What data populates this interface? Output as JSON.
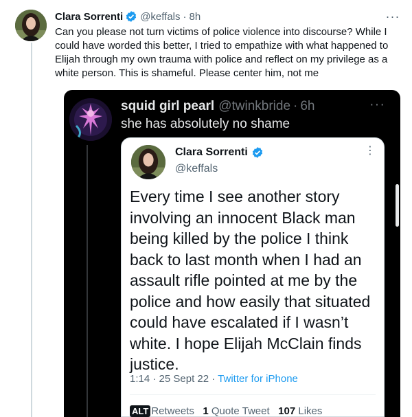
{
  "tweet": {
    "author_name": "Clara Sorrenti",
    "handle": "@keffals",
    "separator": "·",
    "time": "8h",
    "more_label": "···",
    "text": "Can you please not turn victims of police violence into discourse? While I could have worded this better, I tried to empathize with what happened to Elijah through my own trauma with police and reflect on my privilege as a white person. This is shameful. Please center him, not me"
  },
  "quoted_screenshot": {
    "author_name": "squid girl pearl",
    "handle": "@twinkbride",
    "separator": "·",
    "time": "6h",
    "more_label": "···",
    "text": "she has absolutely no shame",
    "inner_tweet": {
      "author_name": "Clara Sorrenti",
      "handle": "@keffals",
      "more_label": "⋮",
      "text": "Every time I see another story involving an innocent Black man being killed by the police I think back to last month when I had an assault rifle pointed at me by the police and how easily that situated could have escalated if I wasn’t white. I hope Elijah McClain finds justice.",
      "time": "1:14 · 25 Sept 22 ·",
      "source": "Twitter for iPhone",
      "alt_badge": "ALT",
      "retweets_label": "Retweets",
      "quote_count": "1",
      "quote_label": "Quote Tweet",
      "likes_count": "107",
      "likes_label": "Likes"
    }
  },
  "colors": {
    "accent": "#1d9bf0",
    "text_primary": "#0f1419",
    "text_secondary": "#536471",
    "screenshot_bg": "#000000"
  }
}
